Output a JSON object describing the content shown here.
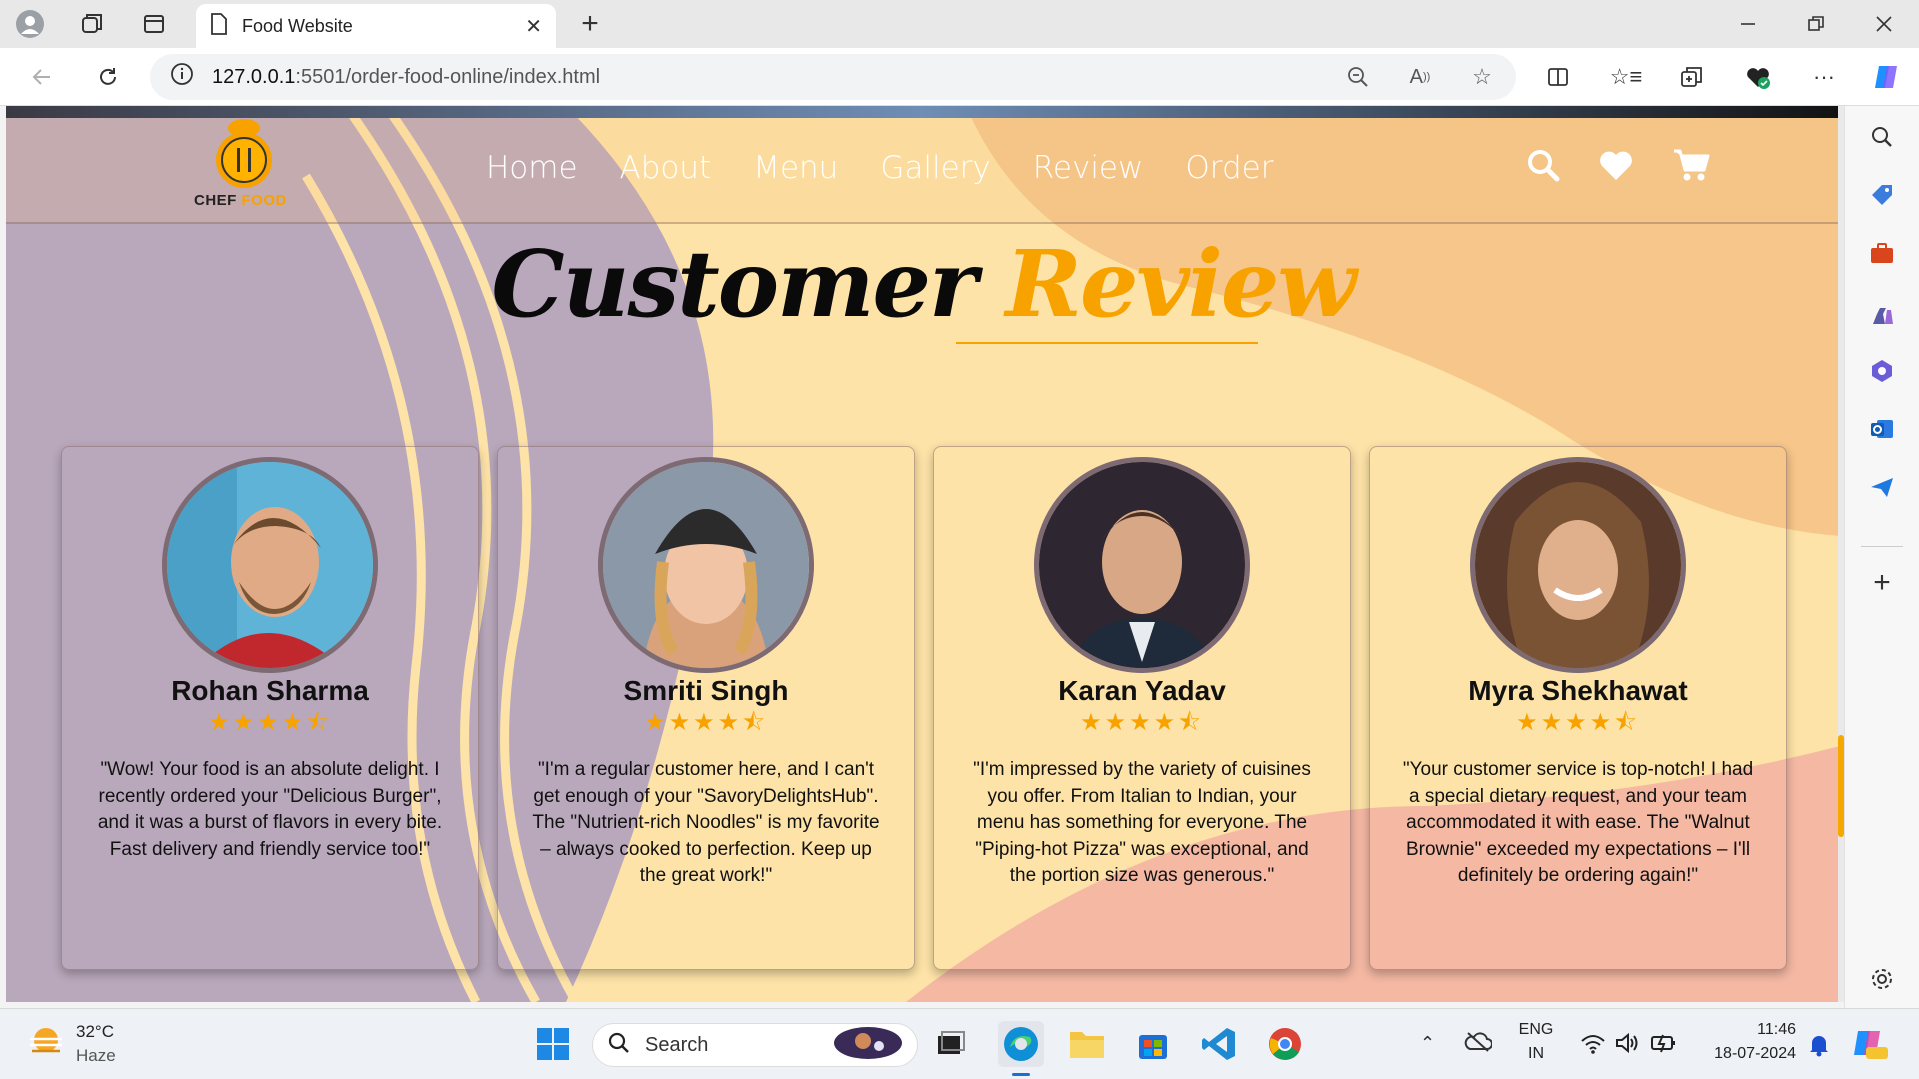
{
  "browser": {
    "tab_title": "Food Website",
    "url_host": "127.0.0.1",
    "url_path": ":5501/order-food-online/index.html"
  },
  "site": {
    "logo_word1": "CHEF",
    "logo_word2": "FOOD",
    "nav": [
      "Home",
      "About",
      "Menu",
      "Gallery",
      "Review",
      "Order"
    ],
    "heading_word1": "Customer",
    "heading_word2": "Review"
  },
  "reviews": [
    {
      "name": "Rohan Sharma",
      "rating": 4.5,
      "stars": "★★★★⯪",
      "quote": "\"Wow! Your food is an absolute delight. I recently ordered your \"Delicious Burger\", and it was a burst of flavors in every bite. Fast delivery and friendly service too!\""
    },
    {
      "name": "Smriti Singh",
      "rating": 4.5,
      "stars": "★★★★⯪",
      "quote": "\"I'm a regular customer here, and I can't get enough of your \"SavoryDelightsHub\". The \"Nutrient-rich Noodles\" is my favorite – always cooked to perfection. Keep up the great work!\""
    },
    {
      "name": "Karan Yadav",
      "rating": 4.5,
      "stars": "★★★★⯪",
      "quote": "\"I'm impressed by the variety of cuisines you offer. From Italian to Indian, your menu has something for everyone. The \"Piping-hot Pizza\" was exceptional, and the portion size was generous.\""
    },
    {
      "name": "Myra Shekhawat",
      "rating": 4.5,
      "stars": "★★★★⯪",
      "quote": "\"Your customer service is top-notch! I had a special dietary request, and your team accommodated it with ease. The \"Walnut Brownie\" exceeded my expectations – I'll definitely be ordering again!\""
    }
  ],
  "taskbar": {
    "weather_temp": "32°C",
    "weather_desc": "Haze",
    "search_label": "Search",
    "lang1": "ENG",
    "lang2": "IN",
    "time": "11:46",
    "date": "18-07-2024"
  },
  "colors": {
    "accent": "#f8a200",
    "lavender": "#b9a8bc",
    "cream": "#fde3a7",
    "peach": "#f5b8a0"
  }
}
